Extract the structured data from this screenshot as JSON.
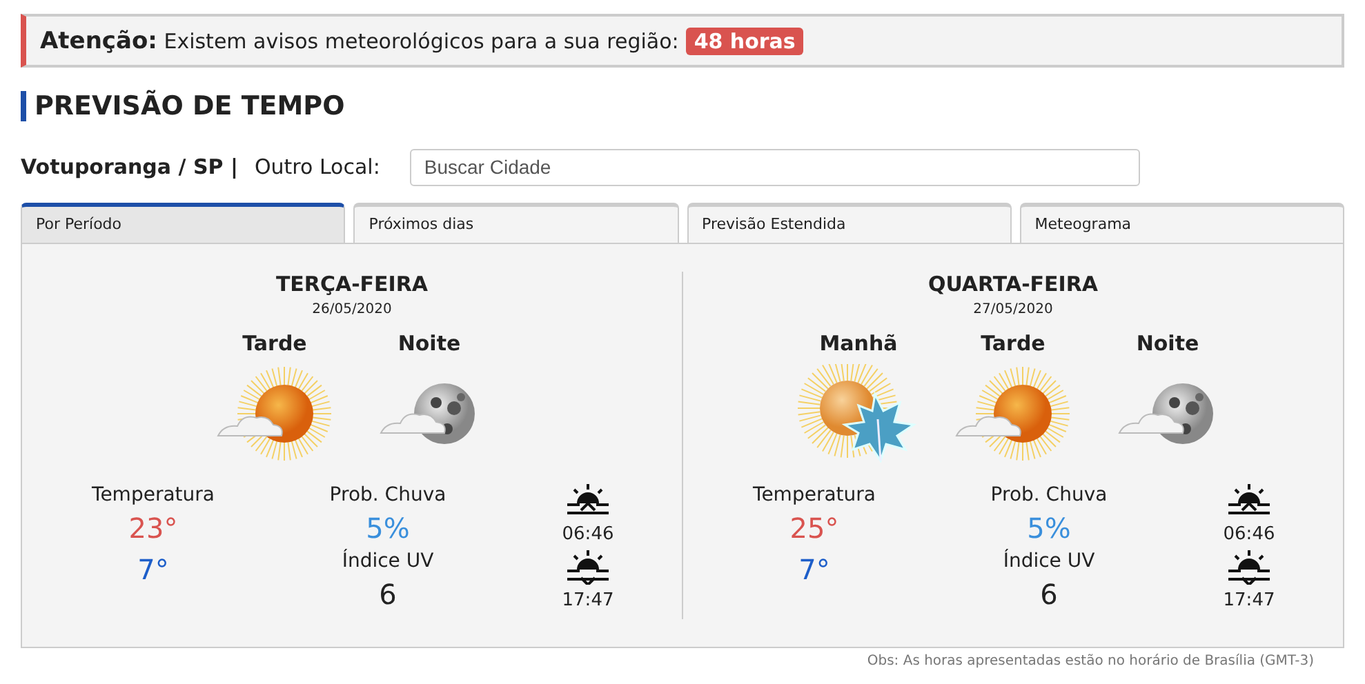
{
  "alert": {
    "text": "**Atenção:** Existem avisos meteorológicos para a sua região:",
    "badge": "48 horas"
  },
  "heading": "PREVISÃO DE TEMPO",
  "location": {
    "current": "Votuporanga / SP |",
    "label": "Outro Local:",
    "search": {
      "placeholder": "Buscar Cidade"
    }
  },
  "tabs": [
    {
      "label": "Por Período",
      "selected": true
    },
    {
      "label": "Próximos dias",
      "selected": false
    },
    {
      "label": "Previsão Estendida",
      "selected": false
    },
    {
      "label": "Meteograma",
      "selected": false
    }
  ],
  "days": [
    {
      "title": "TERÇA-FEIRA",
      "date": "26/05/2020",
      "periods": [
        {
          "name": "Tarde",
          "kind": "sun-cloud"
        },
        {
          "name": "Noite",
          "kind": "moon-cloud"
        }
      ],
      "temperature_label": "Temperatura",
      "temp_max": "23°",
      "temp_min": "7°",
      "rain_label": "Prob. Chuva",
      "rain": "5%",
      "uv_label": "Índice UV",
      "uv": "6",
      "sunrise": "06:46",
      "sunset": "17:47"
    },
    {
      "title": "QUARTA-FEIRA",
      "date": "27/05/2020",
      "periods": [
        {
          "name": "Manhã",
          "kind": "sun-frost"
        },
        {
          "name": "Tarde",
          "kind": "sun-cloud"
        },
        {
          "name": "Noite",
          "kind": "moon-cloud"
        }
      ],
      "temperature_label": "Temperatura",
      "temp_max": "25°",
      "temp_min": "7°",
      "rain_label": "Prob. Chuva",
      "rain": "5%",
      "uv_label": "Índice UV",
      "uv": "6",
      "sunrise": "06:46",
      "sunset": "17:47"
    }
  ],
  "note": "Obs: As horas apresentadas estão no horário de Brasília (GMT-3)"
}
